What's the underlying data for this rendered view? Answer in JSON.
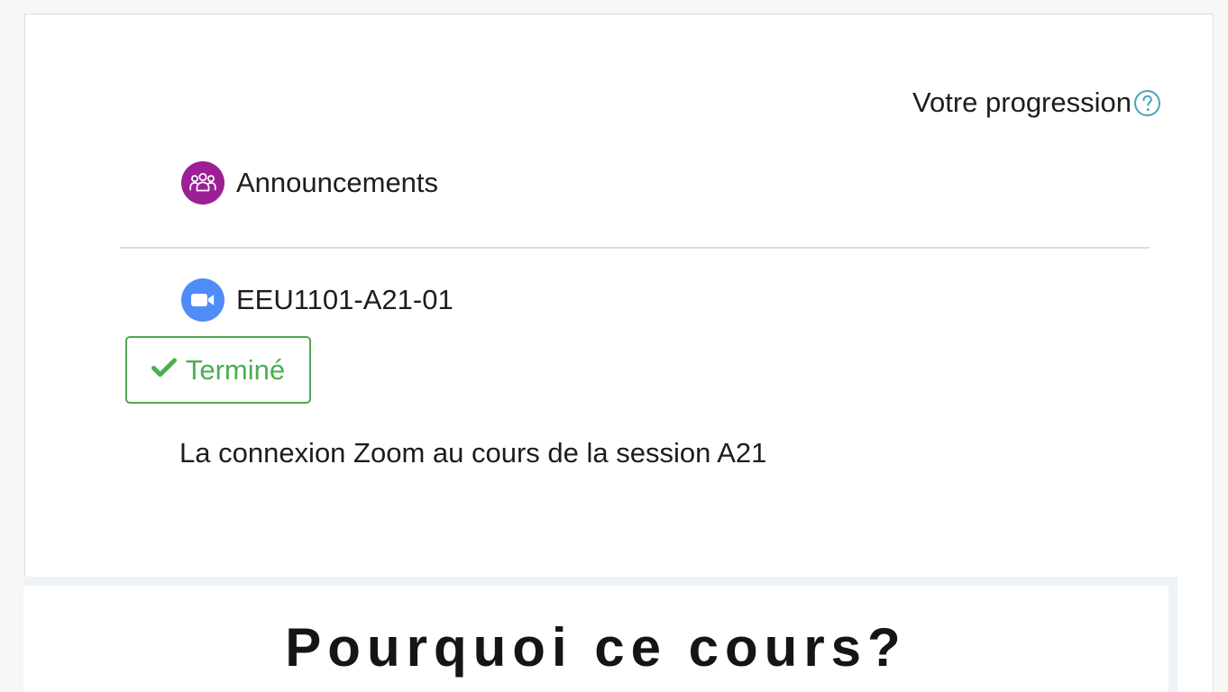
{
  "progress": {
    "label": "Votre progression",
    "help_icon": "help-circle-icon"
  },
  "activities": [
    {
      "name": "Announcements",
      "icon": "users-group-icon",
      "icon_color": "#9c1f96"
    },
    {
      "name": "EEU1101-A21-01",
      "icon": "video-camera-icon",
      "icon_color": "#4f8cf7",
      "completion": {
        "label": "Terminé",
        "icon": "checkmark-icon",
        "color": "#4caf50"
      },
      "description": "La connexion Zoom au cours de la session A21"
    }
  ],
  "section": {
    "title": "Pourquoi ce cours?"
  },
  "colors": {
    "divider": "#dedede",
    "help_icon": "#4aa3b8",
    "section_border": "#eef3f8"
  }
}
